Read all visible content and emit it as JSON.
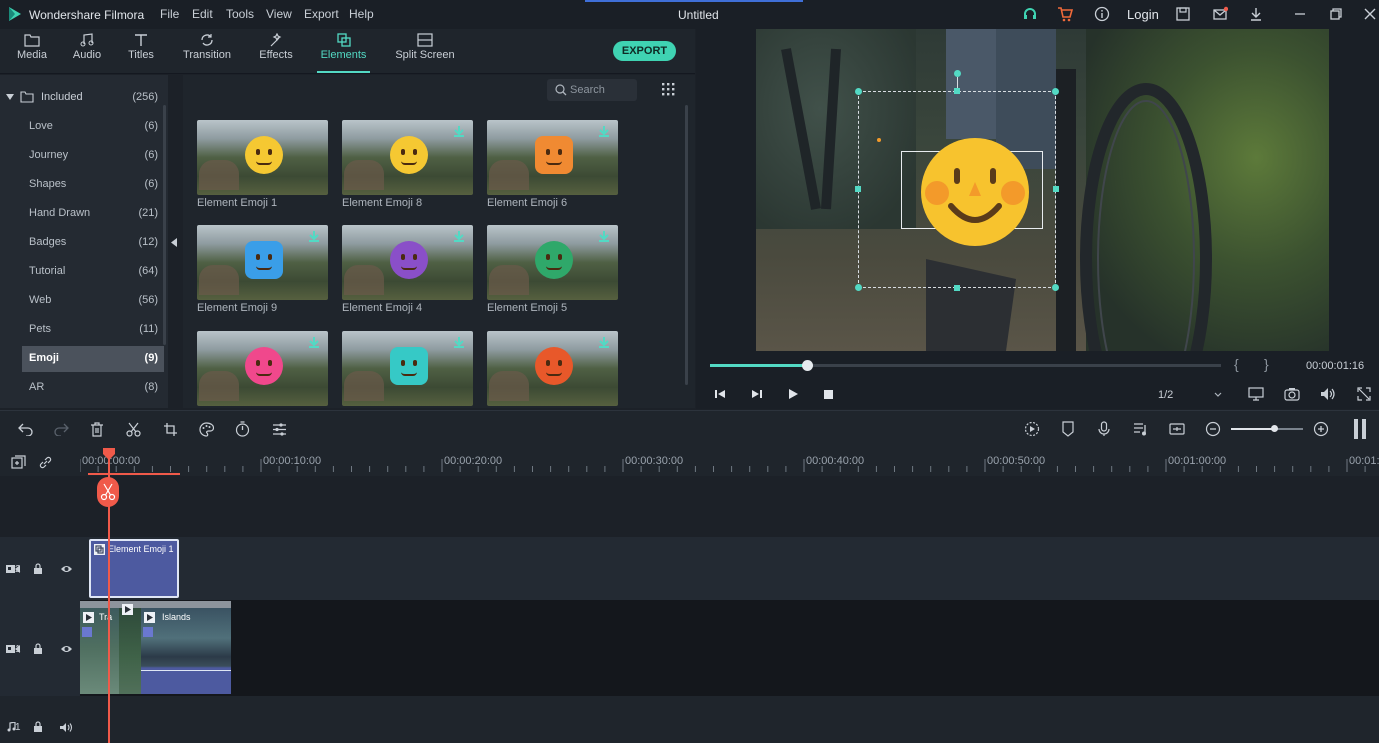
{
  "app": {
    "name": "Wondershare Filmora",
    "doc_title": "Untitled",
    "login_label": "Login"
  },
  "menu": [
    "File",
    "Edit",
    "Tools",
    "View",
    "Export",
    "Help"
  ],
  "toolbar": {
    "tabs": [
      {
        "label": "Media",
        "icon": "folder-icon"
      },
      {
        "label": "Audio",
        "icon": "music-note-icon"
      },
      {
        "label": "Titles",
        "icon": "text-icon"
      },
      {
        "label": "Transition",
        "icon": "transition-icon"
      },
      {
        "label": "Effects",
        "icon": "effects-icon"
      },
      {
        "label": "Elements",
        "icon": "elements-icon",
        "active": true
      },
      {
        "label": "Split Screen",
        "icon": "split-screen-icon"
      }
    ],
    "export_label": "EXPORT"
  },
  "library": {
    "root": {
      "label": "Included",
      "count": "(256)"
    },
    "categories": [
      {
        "label": "Love",
        "count": "(6)"
      },
      {
        "label": "Journey",
        "count": "(6)"
      },
      {
        "label": "Shapes",
        "count": "(6)"
      },
      {
        "label": "Hand Drawn",
        "count": "(21)"
      },
      {
        "label": "Badges",
        "count": "(12)"
      },
      {
        "label": "Tutorial",
        "count": "(64)"
      },
      {
        "label": "Web",
        "count": "(56)"
      },
      {
        "label": "Pets",
        "count": "(11)"
      },
      {
        "label": "Emoji",
        "count": "(9)",
        "selected": true
      },
      {
        "label": "AR",
        "count": "(8)"
      }
    ]
  },
  "search": {
    "placeholder": "Search"
  },
  "elements": [
    {
      "label": "Element Emoji 1",
      "color": "#f5c832",
      "download": false
    },
    {
      "label": "Element Emoji 8",
      "color": "#f5c832",
      "download": true
    },
    {
      "label": "Element Emoji 6",
      "color": "#f08a32",
      "download": true
    },
    {
      "label": "Element Emoji 9",
      "color": "#3a9ee8",
      "download": true
    },
    {
      "label": "Element Emoji 4",
      "color": "#8a4fc8",
      "download": true
    },
    {
      "label": "Element Emoji 5",
      "color": "#2fa86a",
      "download": true
    },
    {
      "label": "",
      "color": "#f0488c",
      "download": true
    },
    {
      "label": "",
      "color": "#36c9c6",
      "download": true
    },
    {
      "label": "",
      "color": "#e8582a",
      "download": true
    }
  ],
  "player": {
    "timecode": "00:00:01:16",
    "quality": "1/2",
    "progress": 0.19
  },
  "timeline": {
    "ruler": [
      "00:00:00:00",
      "00:00:10:00",
      "00:00:20:00",
      "00:00:30:00",
      "00:00:40:00",
      "00:00:50:00",
      "00:01:00:00",
      "00:01:"
    ],
    "tracks": [
      {
        "id": "2",
        "clips": [
          {
            "label": "Element Emoji 1"
          }
        ]
      },
      {
        "id": "1",
        "clips": [
          {
            "label": "Tra"
          },
          {
            "label": ""
          },
          {
            "label": "Islands"
          }
        ]
      },
      {
        "id": "1",
        "type": "audio"
      }
    ]
  },
  "colors": {
    "accent": "#53d9c4",
    "playhead": "#f05a4a",
    "emoji": "#f5c832"
  }
}
